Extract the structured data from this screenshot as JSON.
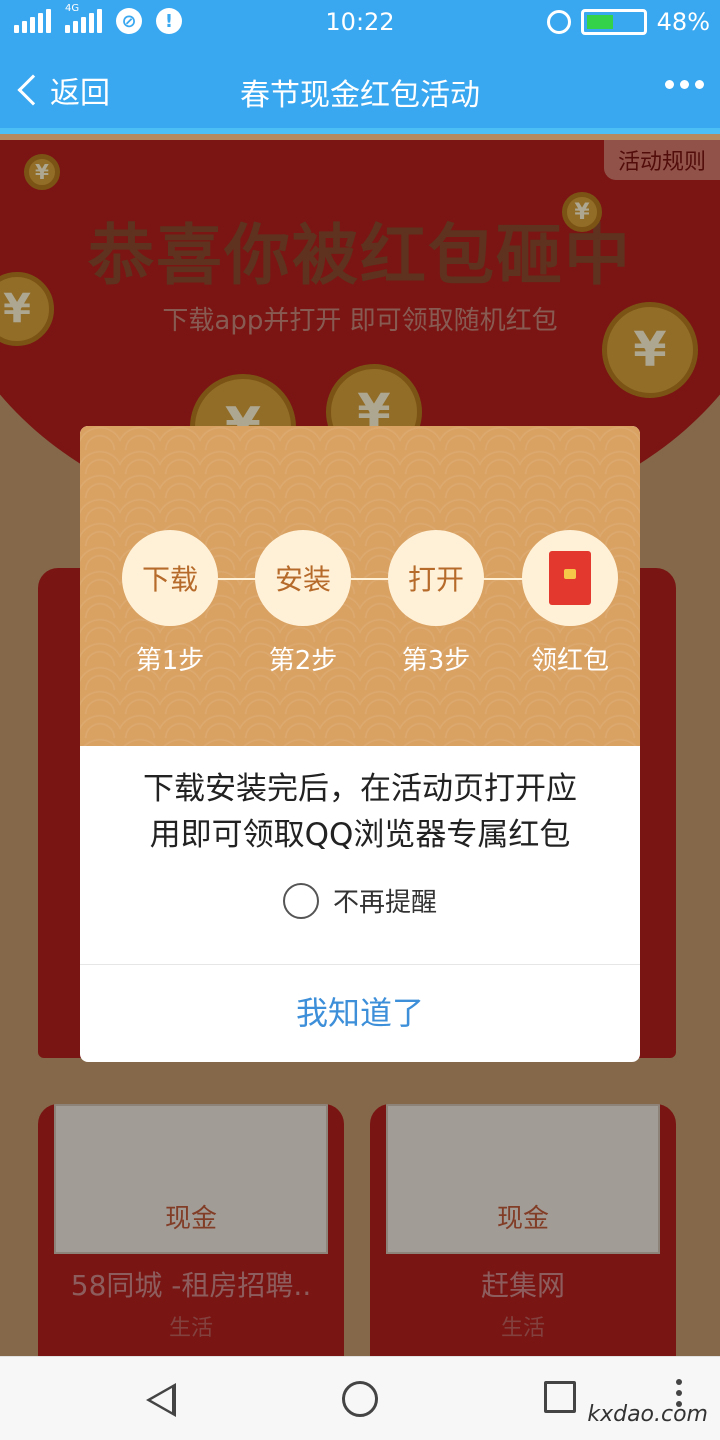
{
  "status_bar": {
    "network": "4G",
    "time": "10:22",
    "battery": "48%",
    "battery_level": 0.48
  },
  "navbar": {
    "back_label": "返回",
    "title": "春节现金红包活动"
  },
  "page": {
    "rules_label": "活动规则",
    "headline": "恭喜你被红包砸中",
    "subline": "下载app并打开   即可领取随机红包",
    "coin_symbol": "¥",
    "cards": [
      {
        "tag": "现金",
        "name": "58同城 -租房招聘..",
        "category": "生活"
      },
      {
        "tag": "现金",
        "name": "赶集网",
        "category": "生活"
      }
    ]
  },
  "dialog": {
    "steps": [
      {
        "circle": "下载",
        "label": "第1步"
      },
      {
        "circle": "安装",
        "label": "第2步"
      },
      {
        "circle": "打开",
        "label": "第3步"
      },
      {
        "circle_icon": "red-packet-icon",
        "label": "领红包"
      }
    ],
    "message_line1": "下载安装完后，在活动页打开应",
    "message_line2": "用即可领取QQ浏览器专属红包",
    "remind_label": "不再提醒",
    "confirm_label": "我知道了"
  },
  "watermark": "kxdao.com",
  "colors": {
    "navbar": "#3aa8f0",
    "dialog_header": "#d9a162",
    "confirm_text": "#3d8fd9",
    "red_packet": "#e2382e"
  }
}
